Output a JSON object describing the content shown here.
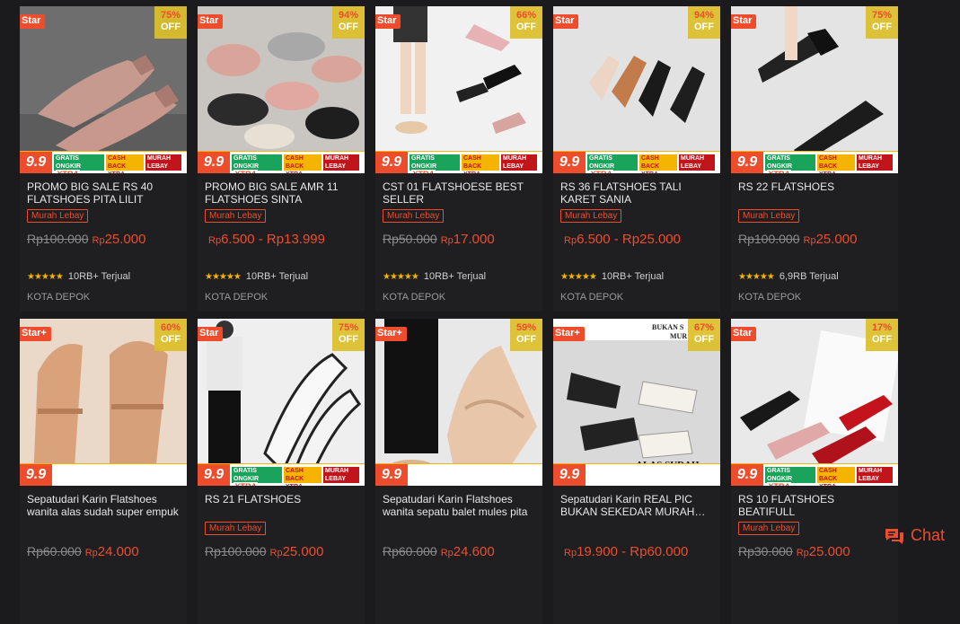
{
  "products": [
    {
      "star": "Star",
      "pct": "75%",
      "off": "OFF",
      "promo": true,
      "title": "PROMO BIG SALE RS 40 FLATSHOES PITA LILIT",
      "tag": "Murah Lebay",
      "old": "Rp100.000",
      "price_prefix": "Rp",
      "price": "25.000",
      "stars": "★★★★★",
      "sold": "10RB+ Terjual",
      "location": "KOTA DEPOK",
      "photo": "pink",
      "ellip": false
    },
    {
      "star": "Star",
      "pct": "94%",
      "off": "OFF",
      "promo": true,
      "title": "PROMO BIG SALE AMR 11 FLATSHOES SINTA",
      "tag": "Murah Lebay",
      "old": "",
      "price_prefix": "Rp",
      "price": "6.500 - Rp13.999",
      "stars": "★★★★★",
      "sold": "10RB+ Terjual",
      "location": "KOTA DEPOK",
      "photo": "multi",
      "ellip": false
    },
    {
      "star": "Star",
      "pct": "66%",
      "off": "OFF",
      "promo": true,
      "title": "CST 01 FLATSHOESE BEST SELLER",
      "tag": "Murah Lebay",
      "old": "Rp50.000",
      "price_prefix": "Rp",
      "price": "17.000",
      "stars": "★★★★★",
      "sold": "10RB+ Terjual",
      "location": "KOTA DEPOK",
      "photo": "legs",
      "ellip": false
    },
    {
      "star": "Star",
      "pct": "94%",
      "off": "OFF",
      "promo": true,
      "title": "RS 36 FLATSHOES TALI KARET SANIA",
      "tag": "Murah Lebay",
      "old": "",
      "price_prefix": "Rp",
      "price": "6.500 - Rp25.000",
      "stars": "★★★★★",
      "sold": "10RB+ Terjual",
      "location": "KOTA DEPOK",
      "photo": "tan",
      "ellip": false
    },
    {
      "star": "Star",
      "pct": "75%",
      "off": "OFF",
      "promo": true,
      "title": "RS 22 FLATSHOES",
      "tag": "Murah Lebay",
      "old": "Rp100.000",
      "price_prefix": "Rp",
      "price": "25.000",
      "stars": "★★★★★",
      "sold": "6,9RB Terjual",
      "location": "KOTA DEPOK",
      "photo": "black",
      "ellip": false
    },
    {
      "star": "Star+",
      "pct": "60%",
      "off": "OFF",
      "promo": false,
      "title": "Sepatudari Karin Flatshoes wanita alas sudah super empuk",
      "tag": "",
      "old": "Rp60.000",
      "price_prefix": "Rp",
      "price": "24.000",
      "stars": "",
      "sold": "",
      "location": "",
      "photo": "nude",
      "ellip": true
    },
    {
      "star": "Star",
      "pct": "75%",
      "off": "OFF",
      "promo": true,
      "title": "RS 21 FLATSHOES",
      "tag": "Murah Lebay",
      "old": "Rp100.000",
      "price_prefix": "Rp",
      "price": "25.000",
      "stars": "",
      "sold": "",
      "location": "",
      "photo": "bw",
      "ellip": false
    },
    {
      "star": "Star+",
      "pct": "59%",
      "off": "OFF",
      "promo": false,
      "title": "Sepatudari Karin Flatshoes wanita sepatu balet mules pita",
      "tag": "",
      "old": "Rp60.000",
      "price_prefix": "Rp",
      "price": "24.600",
      "stars": "",
      "sold": "",
      "location": "",
      "photo": "mule",
      "ellip": true
    },
    {
      "star": "Star+",
      "pct": "67%",
      "off": "OFF",
      "promo": false,
      "title": "Sepatudari Karin REAL PIC BUKAN SEKEDAR MURAH BESTSELLER",
      "tag": "",
      "old": "",
      "price_prefix": "Rp",
      "price": "19.900 - Rp60.000",
      "stars": "",
      "sold": "",
      "location": "",
      "photo": "bukan",
      "ellip": true
    },
    {
      "star": "Star",
      "pct": "17%",
      "off": "OFF",
      "promo": true,
      "title": "RS 10 FLATSHOES BEATIFULL",
      "tag": "Murah Lebay",
      "old": "Rp30.000",
      "price_prefix": "Rp",
      "price": "25.000",
      "stars": "",
      "sold": "",
      "location": "",
      "photo": "red",
      "ellip": false
    }
  ],
  "promo_strip": {
    "nine": "9.9",
    "gratis": "GRATIS ONGKIR",
    "xtra": "XTRA",
    "cashback": "CASH BACK XTRA",
    "murah": "MURAH LEBAY"
  },
  "photo_text": {
    "bukan_top": "BUKAN S...",
    "bukan_top2": "MUR...",
    "alas1": "ALAS SUDAH",
    "alas2": "SUPER EMPUK"
  },
  "chat": {
    "label": "Chat"
  },
  "colors": {
    "accent": "#ee4d2d",
    "discount_bg": "#dcbe28",
    "background": "#1b1b1d"
  }
}
